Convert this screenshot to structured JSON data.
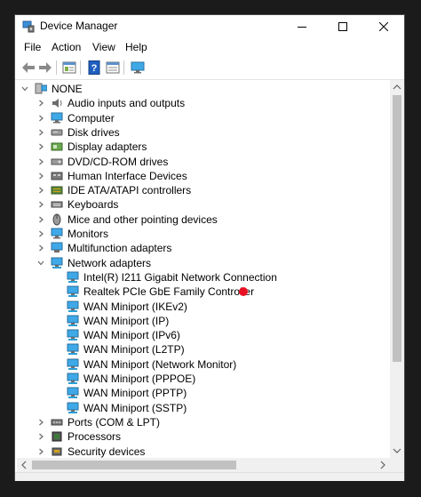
{
  "window": {
    "title": "Device Manager",
    "app_icon": "device-manager-icon"
  },
  "menu": [
    "File",
    "Action",
    "View",
    "Help"
  ],
  "toolbar": {
    "buttons": [
      "back-icon",
      "forward-icon",
      "properties-icon",
      "help-icon",
      "show-hidden-icon",
      "monitor-icon"
    ]
  },
  "tree": {
    "root": {
      "label": "NONE",
      "expanded": true,
      "icon": "computer-icon"
    },
    "categories": [
      {
        "label": "Audio inputs and outputs",
        "icon": "speaker-icon",
        "expanded": false
      },
      {
        "label": "Computer",
        "icon": "monitor-icon",
        "expanded": false
      },
      {
        "label": "Disk drives",
        "icon": "disk-drive-icon",
        "expanded": false
      },
      {
        "label": "Display adapters",
        "icon": "display-adapter-icon",
        "expanded": false
      },
      {
        "label": "DVD/CD-ROM drives",
        "icon": "dvd-icon",
        "expanded": false
      },
      {
        "label": "Human Interface Devices",
        "icon": "hid-icon",
        "expanded": false
      },
      {
        "label": "IDE ATA/ATAPI controllers",
        "icon": "ide-controller-icon",
        "expanded": false
      },
      {
        "label": "Keyboards",
        "icon": "keyboard-icon",
        "expanded": false
      },
      {
        "label": "Mice and other pointing devices",
        "icon": "mouse-icon",
        "expanded": false
      },
      {
        "label": "Monitors",
        "icon": "monitor-icon",
        "expanded": false
      },
      {
        "label": "Multifunction adapters",
        "icon": "multifunction-icon",
        "expanded": false
      },
      {
        "label": "Network adapters",
        "icon": "network-adapter-icon",
        "expanded": true
      },
      {
        "label": "Ports (COM & LPT)",
        "icon": "port-icon",
        "expanded": false
      },
      {
        "label": "Processors",
        "icon": "processor-icon",
        "expanded": false
      },
      {
        "label": "Security devices",
        "icon": "security-icon",
        "expanded": false
      }
    ],
    "network_adapters": [
      "Intel(R) I211 Gigabit Network Connection",
      "Realtek PCIe GbE Family Controller",
      "WAN Miniport (IKEv2)",
      "WAN Miniport (IP)",
      "WAN Miniport (IPv6)",
      "WAN Miniport (L2TP)",
      "WAN Miniport (Network Monitor)",
      "WAN Miniport (PPPOE)",
      "WAN Miniport (PPTP)",
      "WAN Miniport (SSTP)"
    ]
  },
  "colors": {
    "accent": "#0078d7",
    "red_marker": "#e81123",
    "chevron": "#6a6a6a",
    "network_icon": "#2a9fd6"
  }
}
